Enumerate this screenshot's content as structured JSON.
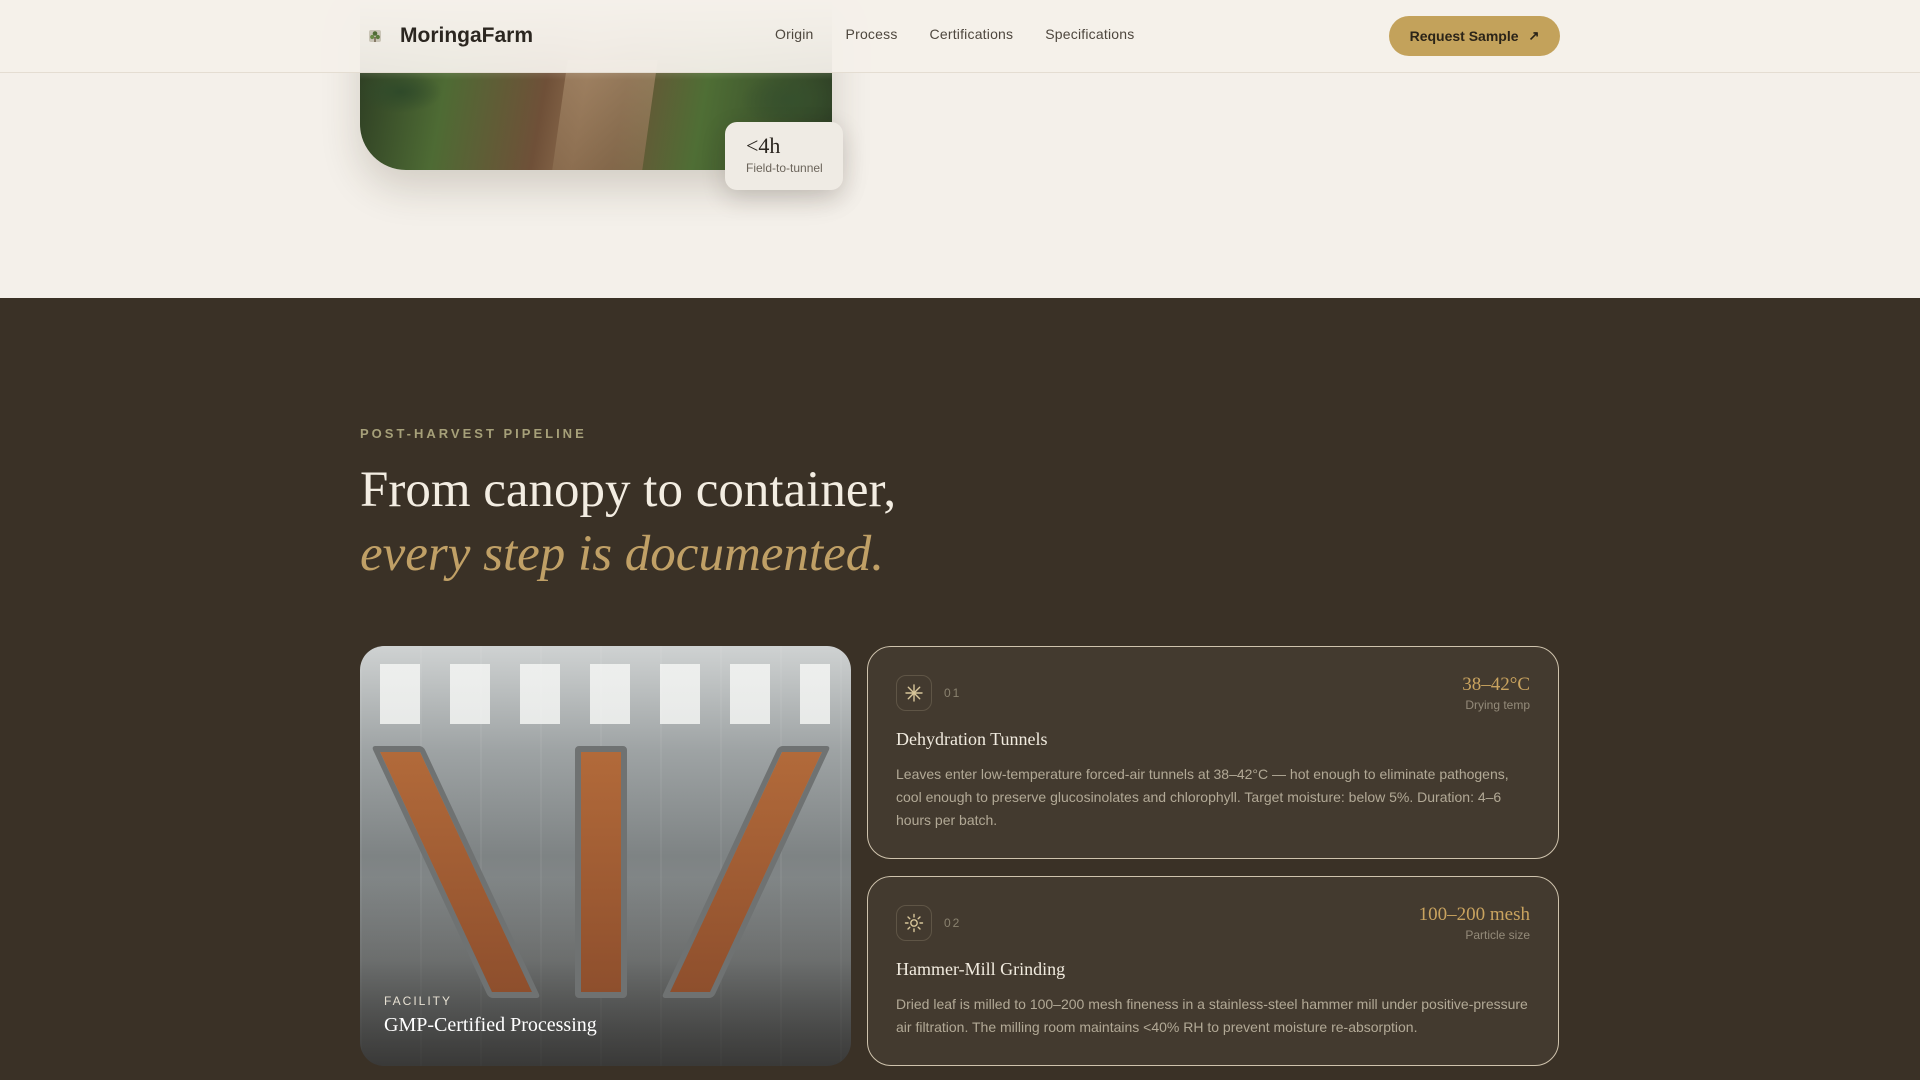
{
  "nav": {
    "brand": "MoringaFarm",
    "links": [
      "Origin",
      "Process",
      "Certifications",
      "Specifications"
    ],
    "cta_label": "Request Sample"
  },
  "hero": {
    "stat_value": "<4h",
    "stat_label": "Field-to-tunnel"
  },
  "pipeline": {
    "eyebrow": "POST-HARVEST PIPELINE",
    "headline_line1": "From canopy to container,",
    "headline_line2": "every step is documented.",
    "facility": {
      "eyebrow": "FACILITY",
      "title": "GMP-Certified Processing"
    },
    "steps": [
      {
        "number": "01",
        "icon": "snowflake-icon",
        "metric_value": "38–42°C",
        "metric_label": "Drying temp",
        "title": "Dehydration Tunnels",
        "description": "Leaves enter low-temperature forced-air tunnels at 38–42°C — hot enough to eliminate pathogens, cool enough to preserve glucosinolates and chlorophyll. Target moisture: below 5%. Duration: 4–6 hours per batch."
      },
      {
        "number": "02",
        "icon": "sun-icon",
        "metric_value": "100–200 mesh",
        "metric_label": "Particle size",
        "title": "Hammer-Mill Grinding",
        "description": "Dried leaf is milled to 100–200 mesh fineness in a stainless-steel hammer mill under positive-pressure air filtration. The milling room maintains <40% RH to prevent moisture re-absorption."
      }
    ]
  },
  "colors": {
    "page_bg": "#f4f0ea",
    "dark_bg": "#3a3126",
    "accent_gold": "#c3a25b",
    "headline_italic": "#c0a066",
    "eyebrow": "#a6a079"
  }
}
